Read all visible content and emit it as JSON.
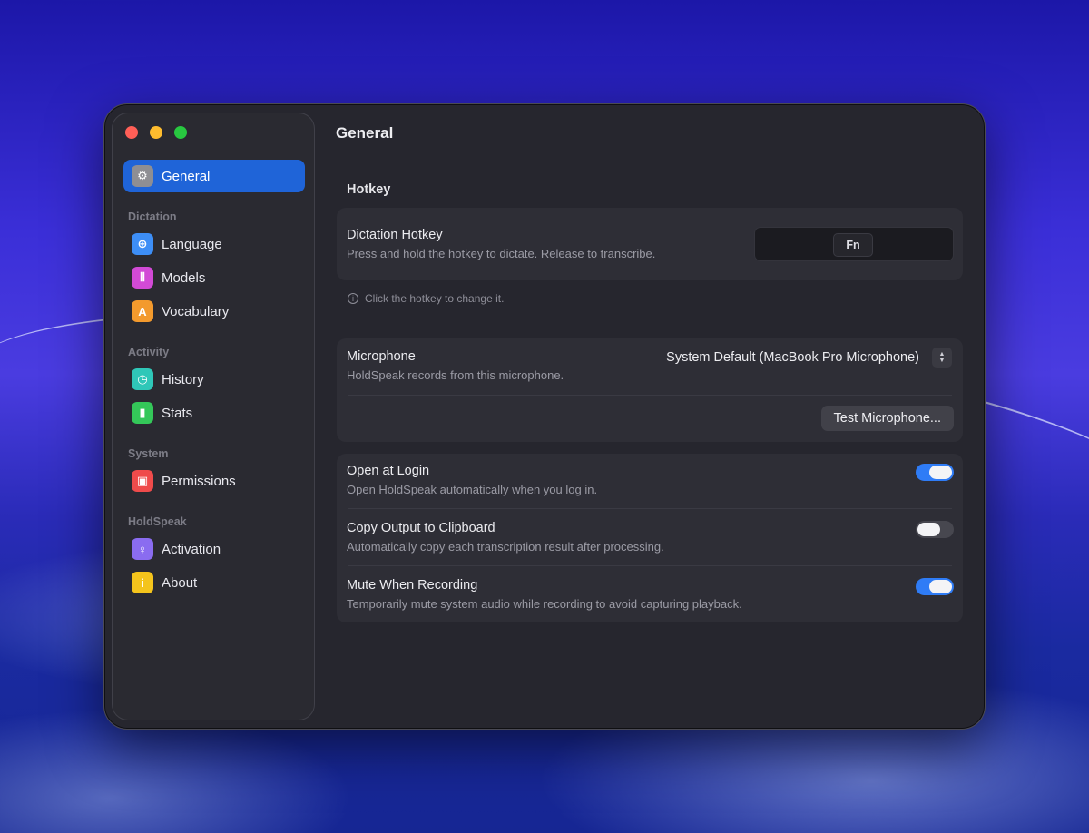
{
  "window": {
    "title": "General"
  },
  "sidebar": {
    "items": [
      {
        "label": "General",
        "icon": "gear-icon",
        "color": "#8e8e93",
        "active": true
      },
      {
        "section": "Dictation"
      },
      {
        "label": "Language",
        "icon": "globe-icon",
        "color": "#3d8ef6"
      },
      {
        "label": "Models",
        "icon": "waveform-icon",
        "color": "#d24ad6"
      },
      {
        "label": "Vocabulary",
        "icon": "dictionary-icon",
        "color": "#f39a2d"
      },
      {
        "section": "Activity"
      },
      {
        "label": "History",
        "icon": "clock-icon",
        "color": "#2fc7b8"
      },
      {
        "label": "Stats",
        "icon": "bar-chart-icon",
        "color": "#34c759"
      },
      {
        "section": "System"
      },
      {
        "label": "Permissions",
        "icon": "lock-icon",
        "color": "#ef4b4b"
      },
      {
        "section": "HoldSpeak"
      },
      {
        "label": "Activation",
        "icon": "key-icon",
        "color": "#8a6cf0"
      },
      {
        "label": "About",
        "icon": "info-icon",
        "color": "#f4c41c"
      }
    ]
  },
  "hotkey": {
    "group_label": "Hotkey",
    "title": "Dictation Hotkey",
    "subtitle": "Press and hold the hotkey to dictate. Release to transcribe.",
    "key": "Fn",
    "hint": "Click the hotkey to change it."
  },
  "microphone": {
    "title": "Microphone",
    "subtitle": "HoldSpeak records from this microphone.",
    "selected": "System Default (MacBook Pro Microphone)",
    "test_button": "Test Microphone..."
  },
  "toggles": [
    {
      "title": "Open at Login",
      "subtitle": "Open HoldSpeak automatically when you log in.",
      "on": true
    },
    {
      "title": "Copy Output to Clipboard",
      "subtitle": "Automatically copy each transcription result after processing.",
      "on": false
    },
    {
      "title": "Mute When Recording",
      "subtitle": "Temporarily mute system audio while recording to avoid capturing playback.",
      "on": true
    }
  ],
  "colors": {
    "accent": "#1f64d8",
    "toggle_on": "#2f7cf6"
  }
}
